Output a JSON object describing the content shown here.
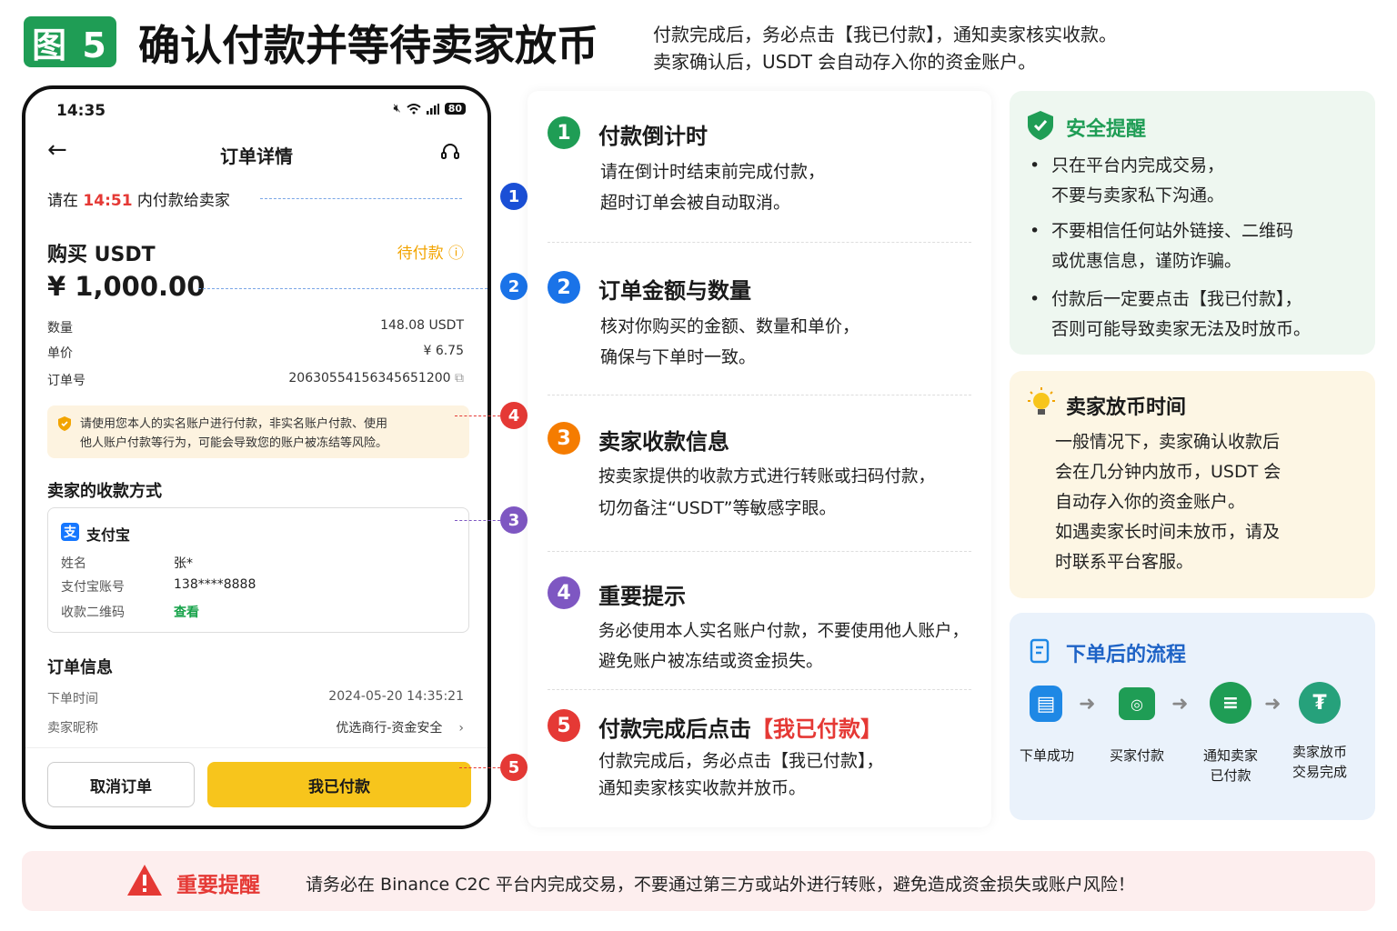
{
  "header": {
    "badge": "图 5",
    "title": "确认付款并等待卖家放币",
    "subtitle_line1": "付款完成后，务必点击【我已付款】，通知卖家核实收款。",
    "subtitle_line2": "卖家确认后，USDT 会自动存入你的资金账户。"
  },
  "phone": {
    "time": "14:35",
    "battery": "80",
    "page_title": "订单详情",
    "hint_prefix": "请在 ",
    "hint_countdown": "14:51",
    "hint_suffix": " 内付款给卖家",
    "buy_label": "购买 USDT",
    "status": "待付款",
    "amount": "¥ 1,000.00",
    "rows": [
      {
        "label": "数量",
        "value": "148.08 USDT"
      },
      {
        "label": "单价",
        "value": "¥ 6.75"
      },
      {
        "label": "订单号",
        "value": "20630554156345651200"
      }
    ],
    "warning_line1": "请使用您本人的实名账户进行付款，非实名账户付款、使用",
    "warning_line2": "他人账户付款等行为，可能会导致您的账户被冻结等风险。",
    "payment_section": "卖家的收款方式",
    "alipay_name": "支付宝",
    "alipay_icon_glyph": "支",
    "pay_rows": [
      {
        "label": "姓名",
        "value": "张*"
      },
      {
        "label": "支付宝账号",
        "value": "138****8888"
      },
      {
        "label": "收款二维码",
        "value": "查看"
      }
    ],
    "order_section": "订单信息",
    "order_rows": [
      {
        "label": "下单时间",
        "value": "2024-05-20 14:35:21"
      },
      {
        "label": "卖家昵称",
        "value": "优选商行-资金安全"
      }
    ],
    "cancel_button": "取消订单",
    "paid_button": "我已付款"
  },
  "callouts": [
    "1",
    "2",
    "4",
    "3",
    "5"
  ],
  "steps": [
    {
      "num": "1",
      "title": "付款倒计时",
      "title_accent": "",
      "line1": "请在倒计时结束前完成付款，",
      "line2": "超时订单会被自动取消。",
      "color": "#1f9d55"
    },
    {
      "num": "2",
      "title": "订单金额与数量",
      "title_accent": "",
      "line1": "核对你购买的金额、数量和单价，",
      "line2": "确保与下单时一致。",
      "color": "#1a73e8"
    },
    {
      "num": "3",
      "title": "卖家收款信息",
      "title_accent": "",
      "line1": "按卖家提供的收款方式进行转账或扫码付款，",
      "line2": "切勿备注“USDT”等敏感字眼。",
      "color": "#f57c00"
    },
    {
      "num": "4",
      "title": "重要提示",
      "title_accent": "",
      "line1": "务必使用本人实名账户付款，不要使用他人账户，",
      "line2": "避免账户被冻结或资金损失。",
      "color": "#7e57c2"
    },
    {
      "num": "5",
      "title": "付款完成后点击",
      "title_accent": "【我已付款】",
      "line1": "付款完成后，务必点击【我已付款】，",
      "line2": "通知卖家核实收款并放币。",
      "color": "#e53935"
    }
  ],
  "safety": {
    "title": "安全提醒",
    "items": [
      {
        "l1": "只在平台内完成交易，",
        "l2": "不要与卖家私下沟通。"
      },
      {
        "l1": "不要相信任何站外链接、二维码",
        "l2": "或优惠信息，谨防诈骗。"
      },
      {
        "l1": "付款后一定要点击【我已付款】，",
        "l2": "否则可能导致卖家无法及时放币。"
      }
    ]
  },
  "release": {
    "title": "卖家放币时间",
    "lines": [
      "一般情况下，卖家确认收款后",
      "会在几分钟内放币，USDT 会",
      "自动存入你的资金账户。",
      "如遇卖家长时间未放币，请及",
      "时联系平台客服。"
    ]
  },
  "flow": {
    "title": "下单后的流程",
    "steps": [
      {
        "l1": "下单成功",
        "l2": "",
        "icon": "order-icon",
        "color": "#1e88e5"
      },
      {
        "l1": "买家付款",
        "l2": "",
        "icon": "wechat-pay-icon",
        "color": "#1f9d55"
      },
      {
        "l1": "通知卖家",
        "l2": "已付款",
        "icon": "chat-icon",
        "color": "#1f9d55"
      },
      {
        "l1": "卖家放币",
        "l2": "交易完成",
        "icon": "tether-icon",
        "color": "#26a17b"
      }
    ]
  },
  "bottom": {
    "title": "重要提醒",
    "text": "请务必在 Binance C2C 平台内完成交易，不要通过第三方或站外进行转账，避免造成资金损失或账户风险！"
  }
}
